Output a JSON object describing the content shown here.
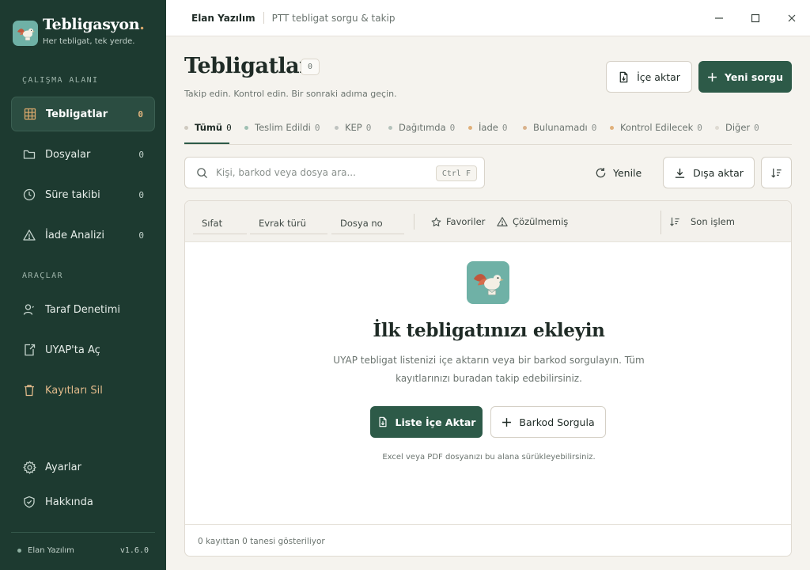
{
  "brand": {
    "name": "Tebligasyon",
    "dot": ".",
    "tagline": "Her tebligat, tek yerde.",
    "logo_icon": "bird-icon"
  },
  "sidebar": {
    "section_workspace": "ÇALIŞMA ALANI",
    "section_tools": "ARAÇLAR",
    "workspace_items": [
      {
        "label": "Tebligatlar",
        "count": "0",
        "icon": "grid-icon",
        "active": true
      },
      {
        "label": "Dosyalar",
        "count": "0",
        "icon": "folder-icon"
      },
      {
        "label": "Süre takibi",
        "count": "0",
        "icon": "clock-icon"
      },
      {
        "label": "İade Analizi",
        "count": "0",
        "icon": "warning-icon"
      }
    ],
    "tool_items": [
      {
        "label": "Taraf Denetimi",
        "icon": "user-check-icon"
      },
      {
        "label": "UYAP'ta Aç",
        "icon": "external-file-icon"
      },
      {
        "label": "Kayıtları Sil",
        "icon": "trash-icon"
      }
    ],
    "bottom_items": [
      {
        "label": "Ayarlar",
        "icon": "gear-icon"
      },
      {
        "label": "Hakkında",
        "icon": "shield-check-icon"
      }
    ],
    "footer_company": "Elan Yazılım",
    "version": "v1.6.0"
  },
  "titlebar": {
    "company": "Elan Yazılım",
    "app": "PTT tebligat sorgu & takip"
  },
  "header": {
    "title": "Tebligatlar",
    "count_badge": "0",
    "subtitle": "Takip edin. Kontrol edin. Bir sonraki adıma geçin.",
    "import_label": "İçe aktar",
    "new_query_label": "Yeni sorgu"
  },
  "tabs": [
    {
      "label": "Tümü",
      "count": "0",
      "color": "#cfcac0"
    },
    {
      "label": "Teslim Edildi",
      "count": "0",
      "color": "#9fc0b3"
    },
    {
      "label": "KEP",
      "count": "0",
      "color": "#bfc3c0"
    },
    {
      "label": "Dağıtımda",
      "count": "0",
      "color": "#b4c2bb"
    },
    {
      "label": "İade",
      "count": "0",
      "color": "#e0b07a"
    },
    {
      "label": "Bulunamadı",
      "count": "0",
      "color": "#d9b28c"
    },
    {
      "label": "Kontrol Edilecek",
      "count": "0",
      "color": "#e0b07a"
    },
    {
      "label": "Diğer",
      "count": "0",
      "color": "#dedad2"
    }
  ],
  "toolbar": {
    "search_placeholder": "Kişi, barkod veya dosya ara...",
    "search_shortcut": "Ctrl F",
    "refresh_label": "Yenile",
    "export_label": "Dışa aktar"
  },
  "table": {
    "columns": [
      "Sıfat",
      "Evrak türü",
      "Dosya no"
    ],
    "filter_favorites": "Favoriler",
    "filter_unresolved": "Çözülmemiş",
    "sort_label": "Son işlem"
  },
  "empty_state": {
    "title": "İlk tebligatınızı ekleyin",
    "description": "UYAP tebligat listenizi içe aktarın veya bir barkod sorgulayın. Tüm kayıtlarınızı buradan takip edebilirsiniz.",
    "import_button": "Liste İçe Aktar",
    "barcode_button": "Barkod Sorgula",
    "note": "Excel veya PDF dosyanızı bu alana sürükleyebilirsiniz."
  },
  "footer": {
    "record_summary": "0 kayıttan 0 tanesi gösteriliyor"
  },
  "colors": {
    "sidebar_bg": "#1d3a30",
    "primary": "#2d5a48",
    "accent": "#e3b57e",
    "logo_bg": "#6fb1a6"
  }
}
